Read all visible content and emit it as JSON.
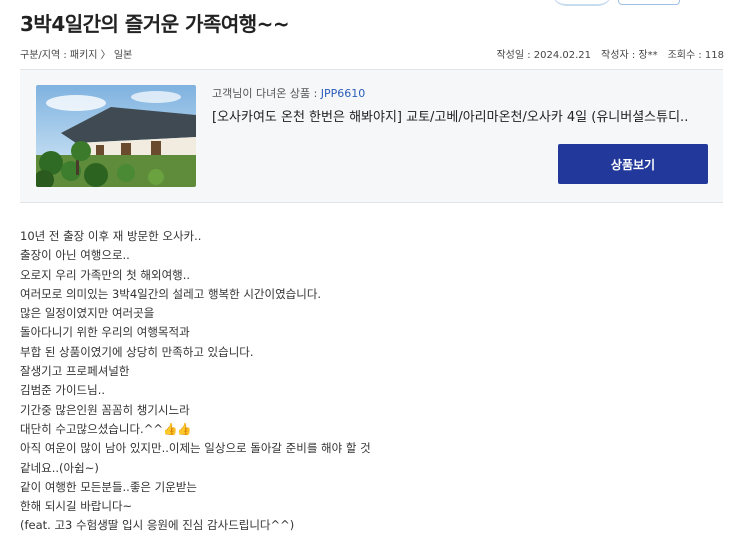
{
  "post": {
    "title": "3박4일간의 즐거운 가족여행~~",
    "meta_left": "구분/지역 : 패키지 〉 일본",
    "date_label": "작성일 : 2024.02.21",
    "author_label": "작성자 : 장**",
    "views_label": "조회수 : 118"
  },
  "product": {
    "label_prefix": "고객님이 다녀온 상품 : ",
    "code": "JPP6610",
    "name": "[오사카여도 온천 한번은 해봐야지] 교토/고베/아리마온천/오사카 4일 (유니버셜스튜디..",
    "button_label": "상품보기"
  },
  "body_lines": [
    "10년 전 출장 이후 재 방문한 오사카..",
    "출장이 아닌 여행으로..",
    "오로지 우리 가족만의 첫 해외여행..",
    "여러모로 의미있는 3박4일간의 설레고 행복한 시간이였습니다.",
    "많은 일정이였지만 여러곳을",
    "돌아다니기 위한 우리의 여행목적과",
    "부합 된 상품이였기에 상당히 만족하고 있습니다.",
    "잘생기고 프로페셔널한",
    "김범준 가이드님..",
    "기간중 많은인원 꼼꼼히 챙기시느라",
    "대단히 수고많으셨습니다.^^👍👍",
    "아직 여운이 많이 남아 있지만..이제는 일상으로 돌아갈 준비를 해야 할 것",
    "같네요..(아쉽~)",
    "같이 여행한 모든분들..좋은 기운받는",
    "한해 되시길 바랍니다~",
    "(feat. 고3 수험생딸 입시 응원에 진심 감사드립니다^^)"
  ]
}
